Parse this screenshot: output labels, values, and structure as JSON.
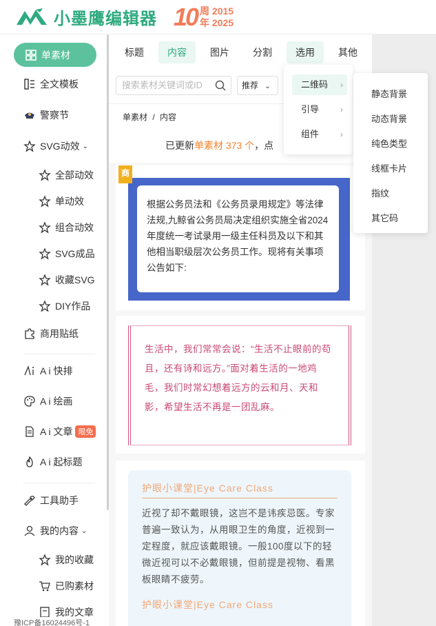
{
  "brand": {
    "name": "小墨鹰编辑器",
    "anniv_num": "10",
    "anniv_line1": "周 2015",
    "anniv_line2": "年 2025",
    "color": "#2eaa7f"
  },
  "sidebar": {
    "items": [
      {
        "label": "单素材"
      },
      {
        "label": "全文模板"
      },
      {
        "label": "警察节"
      },
      {
        "label": "SVG动效"
      },
      {
        "label": "全部动效"
      },
      {
        "label": "单动效"
      },
      {
        "label": "组合动效"
      },
      {
        "label": "SVG成品"
      },
      {
        "label": "收藏SVG"
      },
      {
        "label": "DIY作品"
      },
      {
        "label": "商用贴纸"
      },
      {
        "label": "A i 快排"
      },
      {
        "label": "A i 绘画"
      },
      {
        "label": "A i 文章"
      },
      {
        "label": "A i 起标题"
      },
      {
        "label": "工具助手"
      },
      {
        "label": "我的内容"
      },
      {
        "label": "我的收藏"
      },
      {
        "label": "已购素材"
      },
      {
        "label": "我的文章"
      }
    ],
    "badge": "限免",
    "icp": "豫ICP备16024496号-1"
  },
  "tabs": [
    "标题",
    "内容",
    "图片",
    "分割",
    "选用",
    "其他"
  ],
  "search": {
    "placeholder": "搜索素材关键词或ID",
    "sort": "推荐"
  },
  "breadcrumb": {
    "a": "单素材",
    "sep": "/",
    "b": "内容"
  },
  "updated": {
    "pre": "已更新",
    "hl": "单素材 373 个",
    "post": "，点"
  },
  "cards": {
    "tag": "商",
    "c1": "根据公务员法和《公务员录用规定》等法律法规,九鲸省公务员局决定组织实施全省2024年度统一考试录用一级主任科员及以下和其他相当职级层次公务员工作。现将有关事项公告如下:",
    "c2": "生活中，我们常常会说：“生活不止眼前的苟且，还有诗和远方。”面对着生活的一地鸡毛，我们时常幻想着远方的云和月、天和影，希望生活不再是一团乱麻。",
    "c3_title": "护眼小课堂|Eye Care Class",
    "c3_body": "近视了却不戴眼镜，这岂不是讳疾忌医。专家普遍一致认为，从用眼卫生的角度，近视到一定程度，就应该戴眼镜。一般100度以下的轻微近视可以不必戴眼镜，但前提是视物、看黑板眼睛不疲劳。",
    "c3_title2": "护眼小课堂|Eye Care Class"
  },
  "dropdown1": [
    "二维码",
    "引导",
    "组件"
  ],
  "dropdown2": [
    "静态背景",
    "动态背景",
    "纯色类型",
    "线框卡片",
    "指纹",
    "其它码"
  ]
}
